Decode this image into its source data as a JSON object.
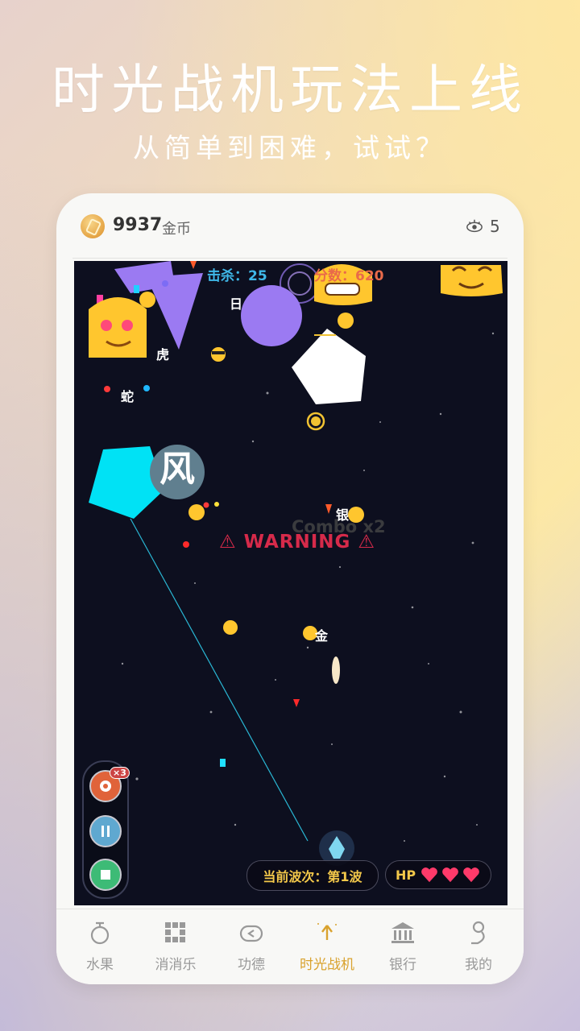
{
  "promo": {
    "headline": "时光战机玩法上线",
    "subline": "从简单到困难，试试？"
  },
  "topbar": {
    "coins": "9937",
    "coin_unit": "金币",
    "views": "5"
  },
  "game": {
    "kills": "击杀：25",
    "score": "分数：620",
    "warning": "⚠ WARNING ⚠",
    "combo": "Combo x2",
    "wave": "当前波次：第1波",
    "hp_label": "HP",
    "hp": 3,
    "big_char": "风",
    "chars": [
      "日",
      "虎",
      "蛇",
      "银",
      "金"
    ],
    "bomb_count": "×3"
  },
  "tabs": [
    {
      "label": "水果",
      "icon": "fruit-icon"
    },
    {
      "label": "消消乐",
      "icon": "grid-icon"
    },
    {
      "label": "功德",
      "icon": "woodfish-icon"
    },
    {
      "label": "时光战机",
      "icon": "plane-icon"
    },
    {
      "label": "银行",
      "icon": "bank-icon"
    },
    {
      "label": "我的",
      "icon": "user-icon"
    }
  ],
  "colors": {
    "accent": "#d9a22e",
    "kill": "#3fb8e8",
    "score": "#e96a4a",
    "warning": "#d62a4a"
  }
}
